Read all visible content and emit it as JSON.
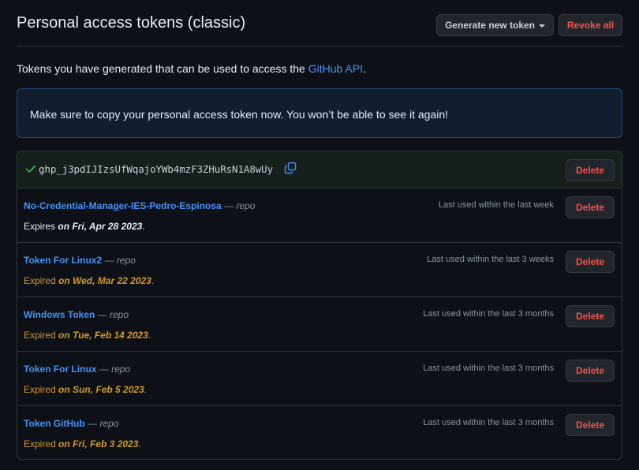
{
  "header": {
    "title": "Personal access tokens (classic)",
    "generate_label": "Generate new token",
    "revoke_label": "Revoke all"
  },
  "intro": {
    "text": "Tokens you have generated that can be used to access the ",
    "link": "GitHub API",
    "suffix": "."
  },
  "flash": {
    "text": "Make sure to copy your personal access token now. You won’t be able to see it again!"
  },
  "new_token": {
    "value": "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",
    "delete_label": "Delete",
    "icons": [
      "check-icon",
      "copy-icon"
    ]
  },
  "tokens": [
    {
      "name": "No-Credential-Manager-IES-Pedro-Espinosa",
      "dash": " — ",
      "scope": "repo",
      "last_used": "Last used within the last week",
      "expire_prefix": "Expires ",
      "expire_date": "on Fri, Apr 28 2023",
      "expire_suffix": ".",
      "status": "active",
      "delete_label": "Delete"
    },
    {
      "name": "Token For Linux2",
      "dash": " — ",
      "scope": "repo",
      "last_used": "Last used within the last 3 weeks",
      "expire_prefix": "Expired ",
      "expire_date": "on Wed, Mar 22 2023",
      "expire_suffix": ".",
      "status": "expired",
      "delete_label": "Delete"
    },
    {
      "name": "Windows Token",
      "dash": " — ",
      "scope": "repo",
      "last_used": "Last used within the last 3 months",
      "expire_prefix": "Expired ",
      "expire_date": "on Tue, Feb 14 2023",
      "expire_suffix": ".",
      "status": "expired",
      "delete_label": "Delete"
    },
    {
      "name": "Token For Linux",
      "dash": " — ",
      "scope": "repo",
      "last_used": "Last used within the last 3 months",
      "expire_prefix": "Expired ",
      "expire_date": "on Sun, Feb 5 2023",
      "expire_suffix": ".",
      "status": "expired",
      "delete_label": "Delete"
    },
    {
      "name": "Token GitHub",
      "dash": " — ",
      "scope": "repo",
      "last_used": "Last used within the last 3 months",
      "expire_prefix": "Expired ",
      "expire_date": "on Fri, Feb 3 2023",
      "expire_suffix": ".",
      "status": "expired",
      "delete_label": "Delete"
    }
  ],
  "colors": {
    "background": "#0d1117",
    "link": "#4493f8",
    "danger": "#f85149",
    "expired": "#d29922",
    "success": "#3fb950"
  }
}
